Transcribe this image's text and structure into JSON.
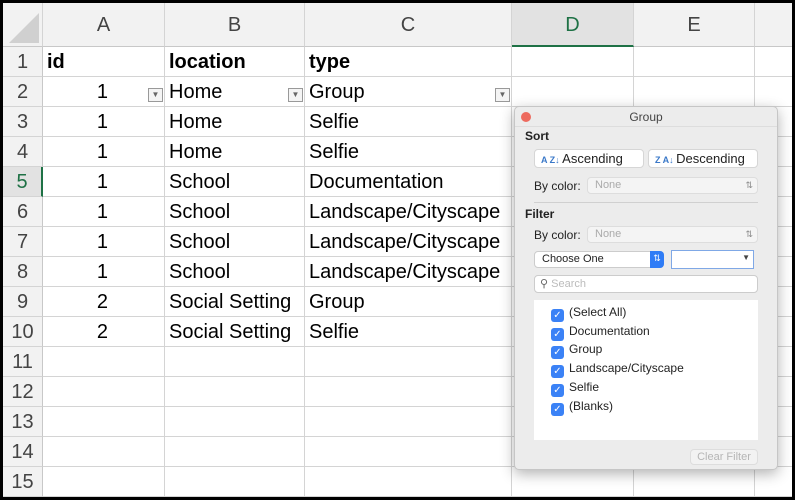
{
  "columns": [
    "A",
    "B",
    "C",
    "D",
    "E"
  ],
  "row_numbers": [
    "1",
    "2",
    "3",
    "4",
    "5",
    "6",
    "7",
    "8",
    "9",
    "10",
    "11",
    "12",
    "13",
    "14",
    "15"
  ],
  "rows": [
    [
      "id",
      "location",
      "type"
    ],
    [
      "1",
      "Home",
      "Group"
    ],
    [
      "1",
      "Home",
      "Selfie"
    ],
    [
      "1",
      "Home",
      "Selfie"
    ],
    [
      "1",
      "School",
      "Documentation"
    ],
    [
      "1",
      "School",
      "Landscape/Cityscape"
    ],
    [
      "1",
      "School",
      "Landscape/Cityscape"
    ],
    [
      "1",
      "School",
      "Landscape/Cityscape"
    ],
    [
      "2",
      "Social Setting",
      "Group"
    ],
    [
      "2",
      "Social Setting",
      "Selfie"
    ]
  ],
  "filter_popup": {
    "title": "Group",
    "sort_label": "Sort",
    "ascending": "Ascending",
    "descending": "Descending",
    "by_color_label": "By color:",
    "sort_color_value": "None",
    "filter_label": "Filter",
    "filter_color_value": "None",
    "condition": "Choose One",
    "search_placeholder": "Search",
    "items": [
      "(Select All)",
      "Documentation",
      "Group",
      "Landscape/Cityscape",
      "Selfie",
      "(Blanks)"
    ],
    "clear_filter": "Clear Filter"
  },
  "colors": {
    "accent": "#1e7145",
    "checkbox": "#3b82f6"
  }
}
